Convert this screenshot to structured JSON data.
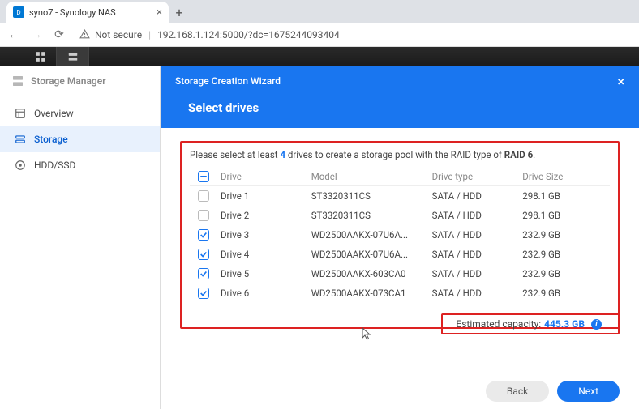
{
  "browser": {
    "tab_title": "syno7 - Synology NAS",
    "url": "192.168.1.124:5000/?dc=1675244093404",
    "security_label": "Not secure"
  },
  "sidebar": {
    "app_title": "Storage Manager",
    "items": [
      {
        "label": "Overview"
      },
      {
        "label": "Storage"
      },
      {
        "label": "HDD/SSD"
      }
    ]
  },
  "wizard": {
    "header": "Storage Creation Wizard",
    "title": "Select drives",
    "instruction_pre": "Please select at least ",
    "instruction_num": "4",
    "instruction_mid": " drives to create a storage pool with the RAID type of ",
    "instruction_type": "RAID 6",
    "instruction_post": ".",
    "columns": {
      "drive": "Drive",
      "model": "Model",
      "type": "Drive type",
      "size": "Drive Size"
    },
    "drives": [
      {
        "checked": false,
        "name": "Drive 1",
        "model": "ST3320311CS",
        "type": "SATA / HDD",
        "size": "298.1 GB"
      },
      {
        "checked": false,
        "name": "Drive 2",
        "model": "ST3320311CS",
        "type": "SATA / HDD",
        "size": "298.1 GB"
      },
      {
        "checked": true,
        "name": "Drive 3",
        "model": "WD2500AAKX-07U6A...",
        "type": "SATA / HDD",
        "size": "232.9 GB"
      },
      {
        "checked": true,
        "name": "Drive 4",
        "model": "WD2500AAKX-07U6A...",
        "type": "SATA / HDD",
        "size": "232.9 GB"
      },
      {
        "checked": true,
        "name": "Drive 5",
        "model": "WD2500AAKX-603CA0",
        "type": "SATA / HDD",
        "size": "232.9 GB"
      },
      {
        "checked": true,
        "name": "Drive 6",
        "model": "WD2500AAKX-073CA1",
        "type": "SATA / HDD",
        "size": "232.9 GB"
      }
    ],
    "estimated_label": "Estimated capacity:",
    "estimated_value": "445.3 GB",
    "back_label": "Back",
    "next_label": "Next"
  }
}
